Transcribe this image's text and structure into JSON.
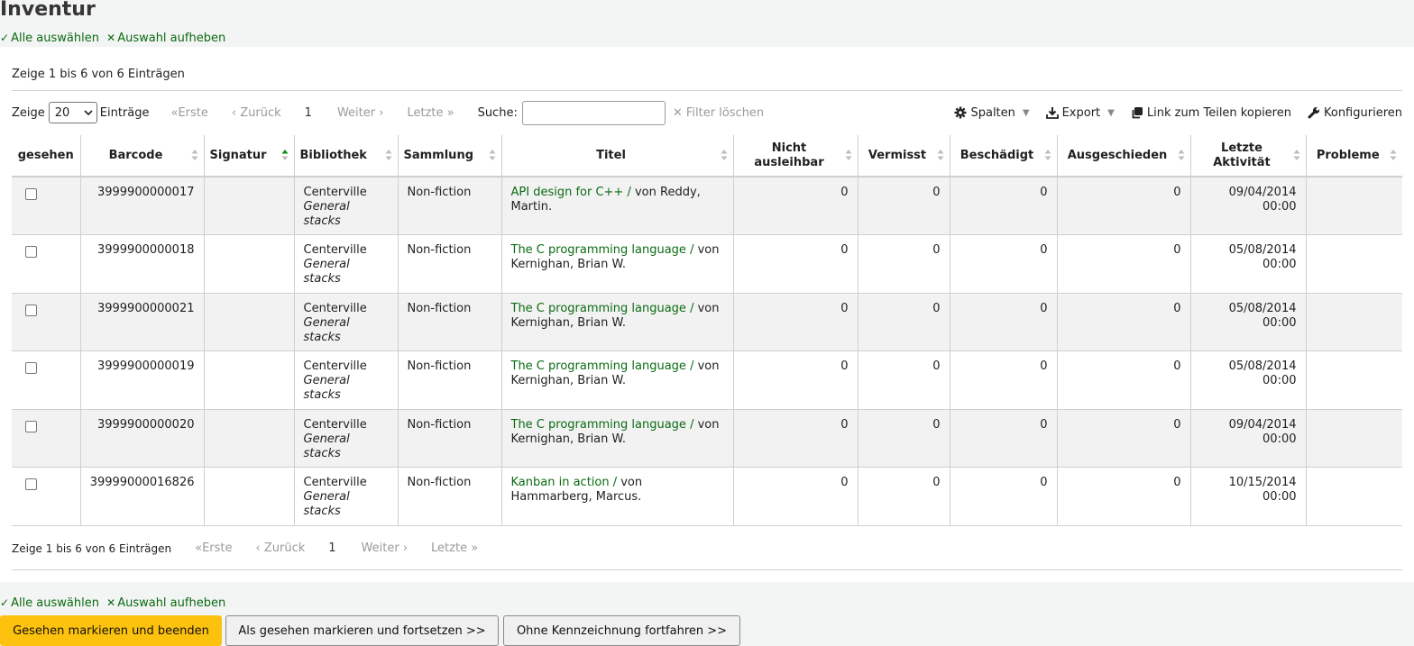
{
  "page": {
    "title": "Inventur"
  },
  "selection": {
    "select_all": "Alle auswählen",
    "clear_all": "Auswahl aufheben"
  },
  "table_info": {
    "top": "Zeige 1 bis 6 von 6 Einträgen",
    "bottom": "Zeige 1 bis 6 von 6 Einträgen"
  },
  "toolbar": {
    "show_label": "Zeige",
    "page_length": "20",
    "entries_label": "Einträge",
    "search_label": "Suche:",
    "search_value": "",
    "filter_clear": "Filter löschen",
    "columns": "Spalten",
    "export": "Export",
    "copy_link": "Link zum Teilen kopieren",
    "configure": "Konfigurieren"
  },
  "pager": {
    "first": "Erste",
    "prev": "Zurück",
    "current": "1",
    "next": "Weiter",
    "last": "Letzte"
  },
  "columns": {
    "seen": "gesehen",
    "barcode": "Barcode",
    "callnumber": "Signatur",
    "library": "Bibliothek",
    "collection": "Sammlung",
    "title": "Titel",
    "notforloan_1": "Nicht",
    "notforloan_2": "ausleihbar",
    "lost": "Vermisst",
    "damaged": "Beschädigt",
    "withdrawn": "Ausgeschieden",
    "lastseen_1": "Letzte",
    "lastseen_2": "Aktivität",
    "problems": "Probleme"
  },
  "rows": [
    {
      "barcode": "3999900000017",
      "callnumber": "",
      "library": "Centerville",
      "location": "General stacks",
      "collection": "Non-fiction",
      "title": "API design for C++ /",
      "author": " von Reddy, Martin.",
      "notforloan": "0",
      "lost": "0",
      "damaged": "0",
      "withdrawn": "0",
      "date": "09/04/2014",
      "time": "00:00",
      "problems": ""
    },
    {
      "barcode": "3999900000018",
      "callnumber": "",
      "library": "Centerville",
      "location": "General stacks",
      "collection": "Non-fiction",
      "title": "The C programming language /",
      "author": " von Kernighan, Brian W.",
      "notforloan": "0",
      "lost": "0",
      "damaged": "0",
      "withdrawn": "0",
      "date": "05/08/2014",
      "time": "00:00",
      "problems": ""
    },
    {
      "barcode": "3999900000021",
      "callnumber": "",
      "library": "Centerville",
      "location": "General stacks",
      "collection": "Non-fiction",
      "title": "The C programming language /",
      "author": " von Kernighan, Brian W.",
      "notforloan": "0",
      "lost": "0",
      "damaged": "0",
      "withdrawn": "0",
      "date": "05/08/2014",
      "time": "00:00",
      "problems": ""
    },
    {
      "barcode": "3999900000019",
      "callnumber": "",
      "library": "Centerville",
      "location": "General stacks",
      "collection": "Non-fiction",
      "title": "The C programming language /",
      "author": " von Kernighan, Brian W.",
      "notforloan": "0",
      "lost": "0",
      "damaged": "0",
      "withdrawn": "0",
      "date": "05/08/2014",
      "time": "00:00",
      "problems": ""
    },
    {
      "barcode": "3999900000020",
      "callnumber": "",
      "library": "Centerville",
      "location": "General stacks",
      "collection": "Non-fiction",
      "title": "The C programming language /",
      "author": " von Kernighan, Brian W.",
      "notforloan": "0",
      "lost": "0",
      "damaged": "0",
      "withdrawn": "0",
      "date": "09/04/2014",
      "time": "00:00",
      "problems": ""
    },
    {
      "barcode": "39999000016826",
      "callnumber": "",
      "library": "Centerville",
      "location": "General stacks",
      "collection": "Non-fiction",
      "title": "Kanban in action /",
      "author": " von Hammarberg, Marcus.",
      "notforloan": "0",
      "lost": "0",
      "damaged": "0",
      "withdrawn": "0",
      "date": "10/15/2014",
      "time": "00:00",
      "problems": ""
    }
  ],
  "buttons": {
    "mark_finish": "Gesehen markieren und beenden",
    "mark_continue": "Als gesehen markieren und fortsetzen >>",
    "continue_unmarked": "Ohne Kennzeichnung fortfahren >>"
  },
  "colors": {
    "link": "#0b6b12",
    "primary_button": "#fdc20e",
    "background": "#f3f4f4"
  }
}
